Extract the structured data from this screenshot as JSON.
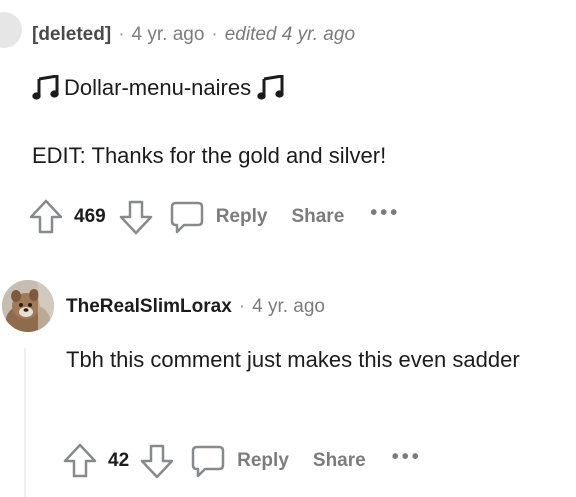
{
  "comment1": {
    "author": "[deleted]",
    "time": "4 yr. ago",
    "edited": "edited 4 yr. ago",
    "body_line1": "Dollar-menu-naires",
    "body_line2": "EDIT: Thanks for the gold and silver!",
    "votes": "469",
    "reply_label": "Reply",
    "share_label": "Share",
    "more_label": "•••"
  },
  "comment2": {
    "author": "TheRealSlimLorax",
    "time": "4 yr. ago",
    "body": "Tbh this comment just makes this even sadder",
    "votes": "42",
    "reply_label": "Reply",
    "share_label": "Share",
    "more_label": "•••"
  },
  "separator": "·",
  "icons": {
    "note": "music-note-icon",
    "upvote": "upvote-arrow-icon",
    "downvote": "downvote-arrow-icon",
    "reply": "speech-bubble-icon",
    "more": "ellipsis-icon"
  },
  "colors": {
    "meta": "#7c7c7c",
    "text": "#1c1c1c",
    "thread_line": "#edeff1"
  }
}
